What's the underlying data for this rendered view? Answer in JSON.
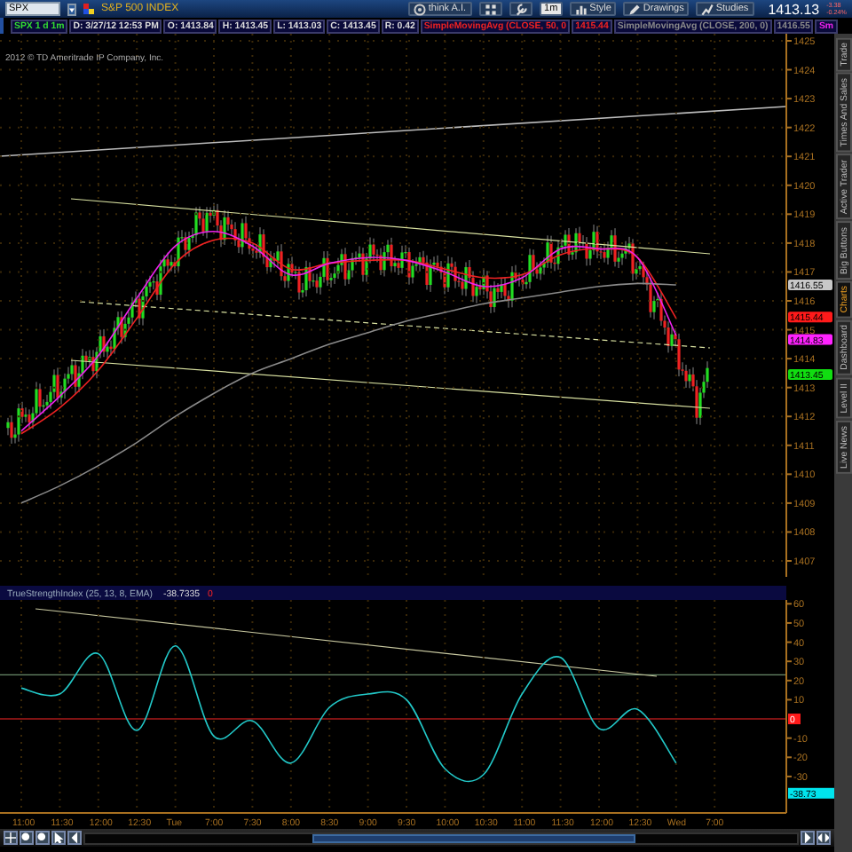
{
  "toolbar": {
    "symbol": "SPX",
    "description": "S&P 500 INDEX",
    "buttons": [
      {
        "kind": "ai",
        "label": "think A.I."
      },
      {
        "kind": "grid"
      },
      {
        "kind": "wrench"
      },
      {
        "kind": "period",
        "label": "1m"
      },
      {
        "kind": "style",
        "label": "Style"
      },
      {
        "kind": "drawings",
        "label": "Drawings"
      },
      {
        "kind": "studies",
        "label": "Studies"
      }
    ],
    "last": "1413.13",
    "change": "-3.38",
    "change_percent": "-0.24%"
  },
  "info_bar": {
    "symbol": "SPX 1 d 1m",
    "quote": [
      "D: 3/27/12 12:53 PM",
      "O: 1413.84",
      "H: 1413.45",
      "L: 1413.03",
      "C: 1413.45",
      "R: 0.42"
    ],
    "study_values": [
      "1415.44",
      "1416.55"
    ]
  },
  "copyright": "2012 © TD Ameritrade IP Company, Inc.",
  "price_chart": {
    "chart_data": {
      "type": "line",
      "grid": true,
      "yticks": [
        1425,
        1424,
        1423,
        1422,
        1421,
        1420,
        1419,
        1418,
        1417,
        1416,
        1415,
        1414,
        1413,
        1412,
        1411,
        1410,
        1409,
        1408,
        1407
      ],
      "ylim": [
        1407,
        1425
      ],
      "series": [
        {
          "name": "SimpleMovingAvg (CLOSE, 50, 0",
          "color": "#ee2222",
          "values": [
            1411.4,
            1412.3,
            1413.6,
            1415.4,
            1417.3,
            1418.1,
            1418.0,
            1417.1,
            1417.3,
            1417.4,
            1417.4,
            1417.1,
            1416.8,
            1416.9,
            1417.6,
            1417.8,
            1417.5,
            1415.4,
            null
          ]
        },
        {
          "name": "SimpleMovingAvg (CLOSE, 200, 0)",
          "color": "#8a8a8a",
          "values": [
            1409.0,
            1409.6,
            1410.3,
            1411.1,
            1412.0,
            1412.8,
            1413.5,
            1414.0,
            1414.5,
            1414.9,
            1415.3,
            1415.6,
            1415.9,
            1416.1,
            1416.3,
            1416.5,
            1416.6,
            1416.55,
            null
          ]
        },
        {
          "name": "Sm",
          "color": "#ee22ee",
          "values": [
            1411.5,
            1412.7,
            1414.1,
            1416.1,
            1417.9,
            1418.4,
            1417.9,
            1416.9,
            1417.3,
            1417.5,
            1417.4,
            1417.0,
            1416.5,
            1416.8,
            1417.8,
            1417.8,
            1417.5,
            1414.8,
            null
          ]
        }
      ]
    },
    "price_labels": [
      {
        "text": "1416.55",
        "color": "#c8c8c8"
      },
      {
        "text": "1415.44",
        "color": "#ff1a1a"
      },
      {
        "text": "1414.83",
        "color": "#ff22ff"
      },
      {
        "text": "1413.45",
        "color": "#11dd11"
      }
    ]
  },
  "lower_study": {
    "value": "-38.7335",
    "flag": "0",
    "chart_data": {
      "type": "line",
      "grid": true,
      "categories": [
        "11:00",
        "11:30",
        "12:00",
        "12:30",
        "Tue",
        "7:00",
        "7:30",
        "8:00",
        "8:30",
        "9:00",
        "9:30",
        "10:00",
        "10:30",
        "11:00",
        "11:30",
        "12:00",
        "12:30",
        "Wed",
        "7:00"
      ],
      "yticks": [
        60,
        50,
        40,
        30,
        20,
        10,
        -10,
        -20,
        -30
      ],
      "ylim": [
        -49,
        62
      ],
      "series": [
        {
          "name": "TrueStrengthIndex (25, 13, 8, EMA)",
          "color": "#22c8c8",
          "values": [
            16,
            13,
            34,
            -6,
            38,
            -9,
            -1,
            -23,
            6,
            13,
            10,
            -26,
            -29,
            13,
            32,
            -5,
            5,
            -23,
            null
          ]
        }
      ]
    },
    "labels": [
      {
        "text": "0",
        "color": "#ff1a1a"
      },
      {
        "text": "-38.73",
        "color": "#00e5ee"
      }
    ]
  },
  "side_tabs": [
    {
      "label": "Trade",
      "selected": false
    },
    {
      "label": "Times And Sales",
      "selected": false
    },
    {
      "label": "Active Trader",
      "selected": false
    },
    {
      "label": "Big Buttons",
      "selected": false
    },
    {
      "label": "Charts",
      "selected": true
    },
    {
      "label": "Dashboard",
      "selected": false
    },
    {
      "label": "Level II",
      "selected": false
    },
    {
      "label": "Live News",
      "selected": false
    }
  ]
}
